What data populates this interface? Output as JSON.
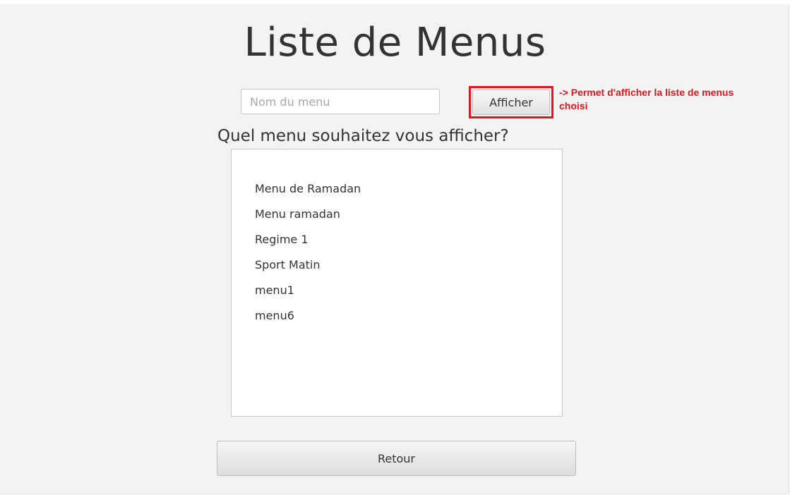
{
  "page": {
    "title": "Liste de Menus",
    "question": "Quel menu souhaitez vous afficher?"
  },
  "search": {
    "placeholder": "Nom du menu",
    "value": ""
  },
  "toolbar": {
    "afficher_label": "Afficher",
    "annotation": "-> Permet d'afficher la liste de menus choisi",
    "annotation_color": "#e8131a"
  },
  "menus": {
    "items": [
      "Menu de Ramadan",
      "Menu ramadan",
      "Regime 1",
      "Sport Matin",
      "menu1",
      "menu6"
    ]
  },
  "footer": {
    "retour_label": "Retour"
  }
}
